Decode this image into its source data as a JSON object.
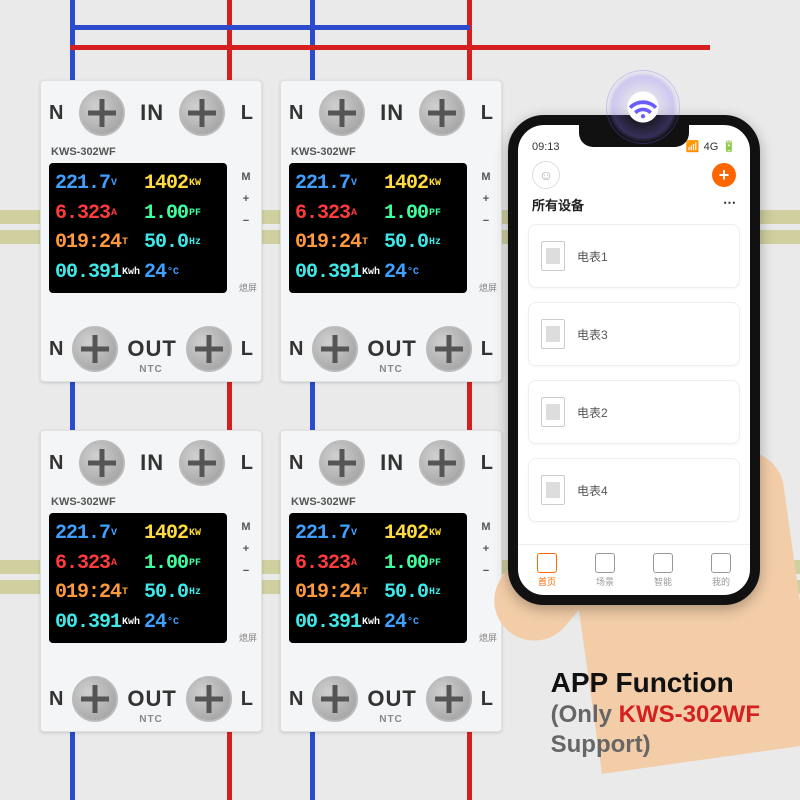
{
  "meter": {
    "model": "KWS-302WF",
    "terminals": {
      "n": "N",
      "l": "L"
    },
    "in_label": "IN",
    "out_label": "OUT",
    "ntc_label": "NTC",
    "side_buttons": [
      "M",
      "+",
      "−",
      "熄屏"
    ],
    "readings": {
      "voltage": {
        "value": "221.7",
        "unit": "V"
      },
      "power": {
        "value": "1402",
        "unit": "KW"
      },
      "current": {
        "value": "6.323",
        "unit": "A"
      },
      "pf": {
        "value": "1.00",
        "unit": "PF"
      },
      "timer": {
        "value": "019:24",
        "unit": "T"
      },
      "freq": {
        "value": "50.0",
        "unit": "Hz"
      },
      "energy": {
        "value": "00.391",
        "unit": "Kwh"
      },
      "temp": {
        "value": "24",
        "unit": "°C"
      }
    }
  },
  "phone": {
    "time": "09:13",
    "signal": "4G",
    "add_button": "+",
    "section_title": "所有设备",
    "more": "⋯",
    "devices": [
      {
        "name": "电表1"
      },
      {
        "name": "电表3"
      },
      {
        "name": "电表2"
      },
      {
        "name": "电表4"
      }
    ],
    "tabs": [
      {
        "label": "首页",
        "active": true
      },
      {
        "label": "场景"
      },
      {
        "label": "智能"
      },
      {
        "label": "我的"
      }
    ]
  },
  "caption": {
    "line1": "APP Function",
    "line2_a": "(Only ",
    "line2_b": "KWS-302WF",
    "line2_c": " Support)"
  }
}
